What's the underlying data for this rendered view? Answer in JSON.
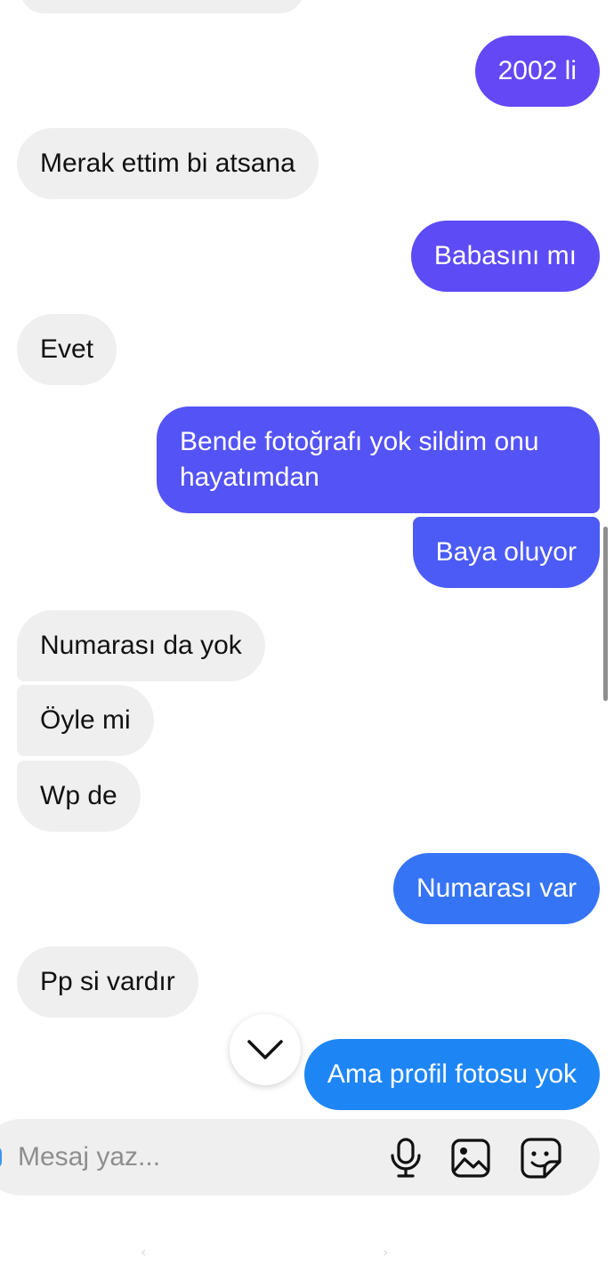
{
  "colors": {
    "incoming_bg": "#efefef",
    "outgoing_gradient_top": "#6a4bf5",
    "outgoing_gradient_bottom": "#1e88f5",
    "composer_bg": "#efefef",
    "placeholder": "#8e8e8e"
  },
  "messages": [
    {
      "direction": "outgoing",
      "text": "2002 li",
      "color": "#6448f6"
    },
    {
      "direction": "incoming",
      "text": "Merak ettim bi atsana"
    },
    {
      "direction": "outgoing",
      "text": "Babasını mı",
      "color": "#5d4bf6"
    },
    {
      "direction": "incoming",
      "text": "Evet"
    },
    {
      "direction": "outgoing",
      "text": "Bende fotoğrafı yok sildim onu hayatımdan",
      "color": "#5453f5"
    },
    {
      "direction": "outgoing",
      "text": "Baya oluyor",
      "color": "#4c5bf5"
    },
    {
      "direction": "incoming",
      "text": "Numarası da yok"
    },
    {
      "direction": "incoming",
      "text": "Öyle mi"
    },
    {
      "direction": "incoming",
      "text": "Wp de"
    },
    {
      "direction": "outgoing",
      "text": "Numarası var",
      "color": "#3574f5"
    },
    {
      "direction": "incoming",
      "text": "Pp si vardır"
    },
    {
      "direction": "outgoing",
      "text": "Ama profil fotosu yok",
      "color": "#1e86f4"
    }
  ],
  "composer": {
    "placeholder": "Mesaj yaz...",
    "icons": [
      "microphone-icon",
      "gallery-icon",
      "sticker-icon"
    ]
  },
  "scroll_button": {
    "icon": "chevron-down-icon"
  }
}
